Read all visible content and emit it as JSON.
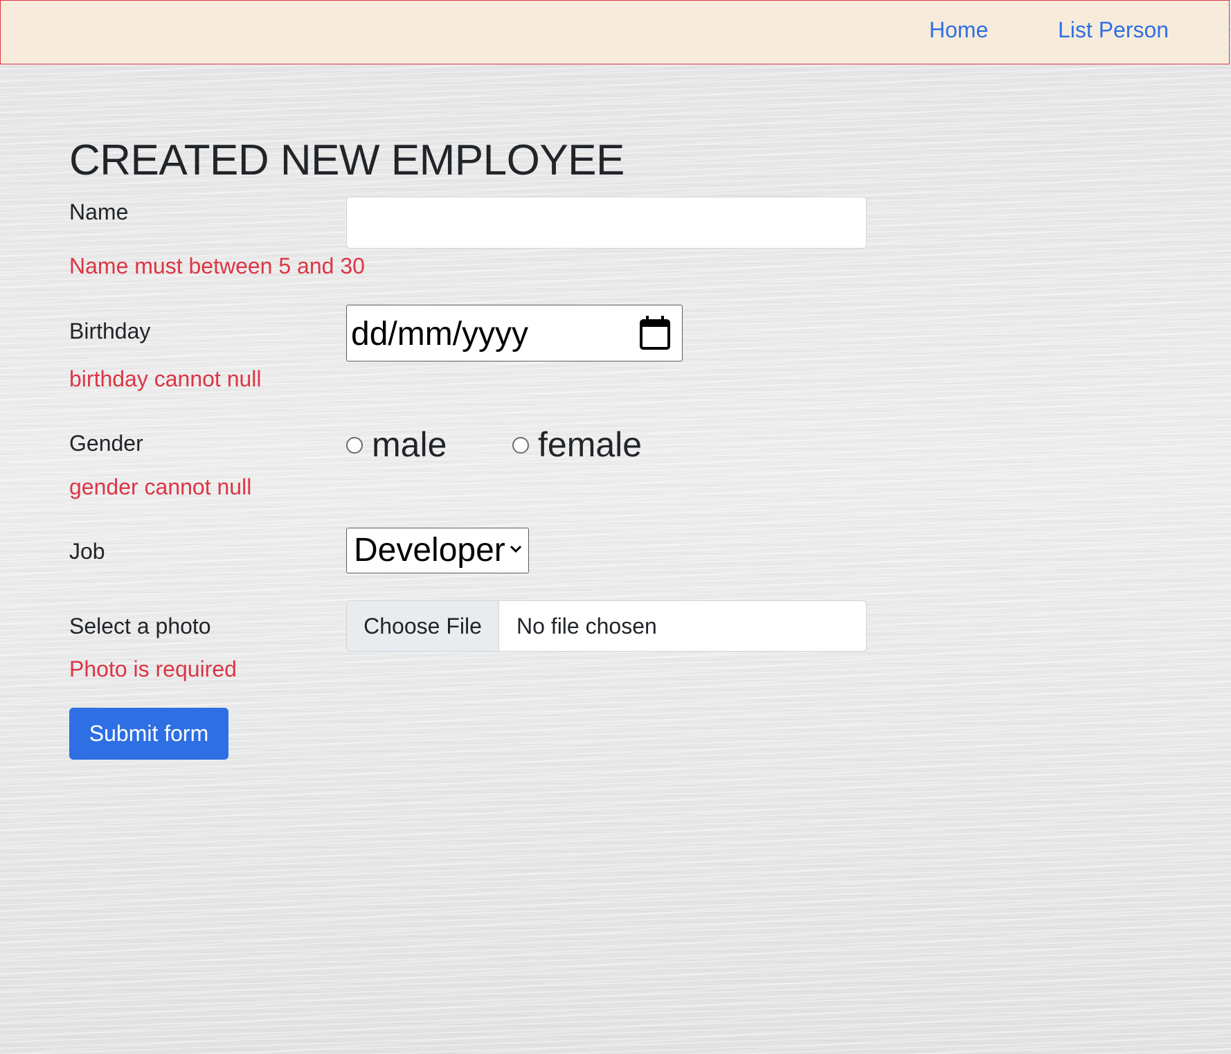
{
  "nav": {
    "home_label": "Home",
    "list_label": "List Person"
  },
  "form": {
    "title": "CREATED NEW EMPLOYEE",
    "name": {
      "label": "Name",
      "value": "",
      "error": "Name must between 5 and 30"
    },
    "birthday": {
      "label": "Birthday",
      "placeholder": "dd/mm/yyyy",
      "error": "birthday cannot null",
      "icon": "calendar-icon"
    },
    "gender": {
      "label": "Gender",
      "options": [
        "male",
        "female"
      ],
      "selected": null,
      "error": "gender cannot null"
    },
    "job": {
      "label": "Job",
      "selected": "Developer",
      "icon": "chevron-down-icon"
    },
    "photo": {
      "label": "Select a photo",
      "button_label": "Choose File",
      "status": "No file chosen",
      "error": "Photo is required"
    },
    "submit_label": "Submit form"
  },
  "colors": {
    "navbar_bg": "#f7ecdc",
    "navbar_border": "#dc3545",
    "link": "#2f6fe4",
    "error": "#dc3545",
    "primary": "#2f6fe4"
  }
}
